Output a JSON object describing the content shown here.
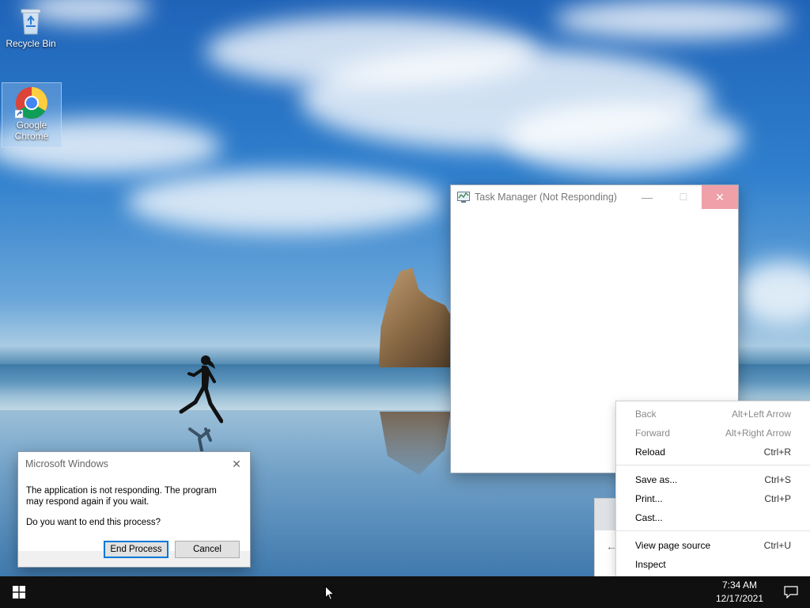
{
  "desktop": {
    "icons": [
      {
        "label": "Recycle Bin",
        "icon": "recycle-bin-icon"
      },
      {
        "label": "Google Chrome",
        "icon": "chrome-icon"
      }
    ]
  },
  "task_manager": {
    "title": "Task Manager (Not Responding)",
    "icon": "task-manager-icon",
    "minimize": "—",
    "maximize": "☐",
    "close": "✕",
    "close_color": "#f0a0a8"
  },
  "dialog": {
    "title": "Microsoft Windows",
    "message": "The application is not responding. The program may respond again if you wait.",
    "question": "Do you want to end this process?",
    "end_process_label": "End Process",
    "cancel_label": "Cancel"
  },
  "context_menu": {
    "groups": [
      [
        {
          "label": "Back",
          "shortcut": "Alt+Left Arrow",
          "enabled": false
        },
        {
          "label": "Forward",
          "shortcut": "Alt+Right Arrow",
          "enabled": false
        },
        {
          "label": "Reload",
          "shortcut": "Ctrl+R",
          "enabled": true
        }
      ],
      [
        {
          "label": "Save as...",
          "shortcut": "Ctrl+S",
          "enabled": true
        },
        {
          "label": "Print...",
          "shortcut": "Ctrl+P",
          "enabled": true
        },
        {
          "label": "Cast...",
          "shortcut": "",
          "enabled": true
        }
      ],
      [
        {
          "label": "View page source",
          "shortcut": "Ctrl+U",
          "enabled": true
        },
        {
          "label": "Inspect",
          "shortcut": "",
          "enabled": true
        }
      ]
    ]
  },
  "taskbar": {
    "time": "7:34 AM",
    "date": "12/17/2021",
    "start_icon": "windows-logo-icon",
    "notification_icon": "action-center-icon"
  }
}
